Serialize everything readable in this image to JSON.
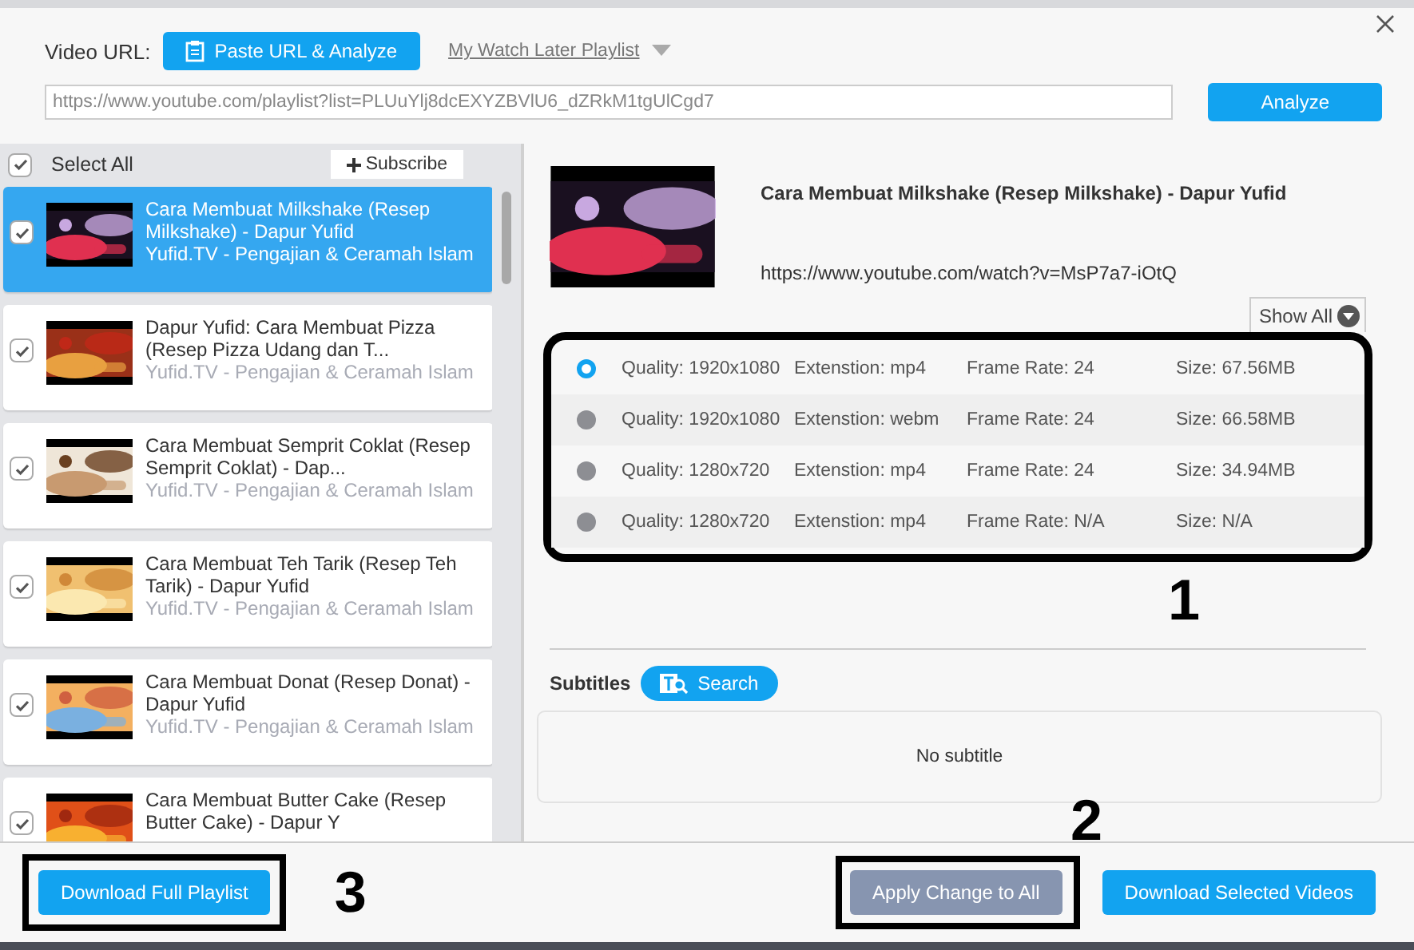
{
  "header": {
    "url_label": "Video URL:",
    "paste_button": "Paste URL & Analyze",
    "playlist_link": "My Watch Later Playlist",
    "url_value": "https://www.youtube.com/playlist?list=PLUuYlj8dcEXYZBVlU6_dZRkM1tgUlCgd7",
    "analyze_button": "Analyze"
  },
  "sidebar": {
    "select_all": {
      "label": "Select All",
      "checked": true
    },
    "subscribe_button": "Subscribe",
    "items": [
      {
        "title": "Cara Membuat Milkshake (Resep Milkshake) - Dapur Yufid",
        "channel": "Yufid.TV - Pengajian & Ceramah Islam",
        "checked": true,
        "selected": true
      },
      {
        "title": "Dapur Yufid: Cara Membuat Pizza (Resep Pizza Udang dan T...",
        "channel": "Yufid.TV - Pengajian & Ceramah Islam",
        "checked": true,
        "selected": false
      },
      {
        "title": "Cara Membuat Semprit Coklat (Resep Semprit Coklat) - Dap...",
        "channel": "Yufid.TV - Pengajian & Ceramah Islam",
        "checked": true,
        "selected": false
      },
      {
        "title": "Cara Membuat Teh Tarik (Resep Teh Tarik) - Dapur Yufid",
        "channel": "Yufid.TV - Pengajian & Ceramah Islam",
        "checked": true,
        "selected": false
      },
      {
        "title": "Cara Membuat Donat (Resep Donat) - Dapur Yufid",
        "channel": "Yufid.TV - Pengajian & Ceramah Islam",
        "checked": true,
        "selected": false
      },
      {
        "title": "Cara Membuat Butter Cake (Resep Butter Cake) - Dapur Y",
        "checked": true,
        "selected": false
      }
    ]
  },
  "detail": {
    "title": "Cara Membuat Milkshake (Resep Milkshake) - Dapur Yufid",
    "url": "https://www.youtube.com/watch?v=MsP7a7-iOtQ",
    "show_all": "Show All",
    "formats": [
      {
        "quality": "Quality: 1920x1080",
        "extension": "Extenstion: mp4",
        "frame_rate": "Frame Rate: 24",
        "size": "Size: 67.56MB",
        "selected": true
      },
      {
        "quality": "Quality: 1920x1080",
        "extension": "Extenstion: webm",
        "frame_rate": "Frame Rate: 24",
        "size": "Size: 66.58MB",
        "selected": false
      },
      {
        "quality": "Quality: 1280x720",
        "extension": "Extenstion: mp4",
        "frame_rate": "Frame Rate: 24",
        "size": "Size: 34.94MB",
        "selected": false
      },
      {
        "quality": "Quality: 1280x720",
        "extension": "Extenstion: mp4",
        "frame_rate": "Frame Rate: N/A",
        "size": "Size: N/A",
        "selected": false
      }
    ],
    "subtitles": {
      "label": "Subtitles",
      "search_button": "Search",
      "empty": "No subtitle"
    }
  },
  "footer": {
    "full_playlist_button": "Download Full Playlist",
    "apply_button": "Apply Change to All",
    "download_selected_button": "Download Selected Videos"
  },
  "annotations": [
    "1",
    "2",
    "3"
  ]
}
